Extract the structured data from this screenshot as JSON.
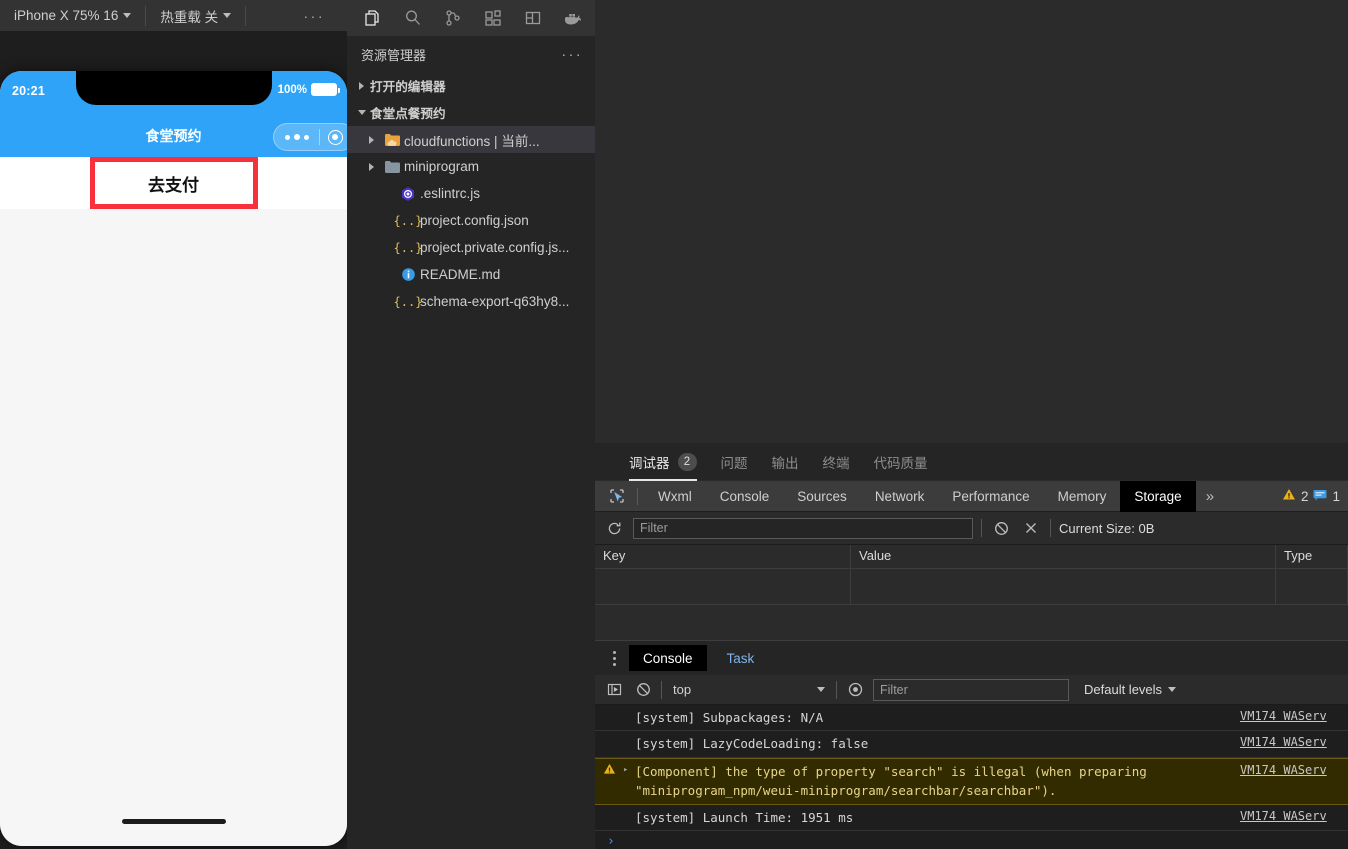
{
  "simulator": {
    "toolbar": {
      "device": "iPhone X 75% 16",
      "hot_reload": "热重载 关",
      "more": "···"
    },
    "phone": {
      "status_time": "20:21",
      "battery_pct": "100%",
      "nav_title": "食堂预约",
      "pay_button": "去支付"
    }
  },
  "activity_bar": {
    "icons": [
      {
        "name": "explorer-icon",
        "label": "资源管理器"
      },
      {
        "name": "search-icon",
        "label": "搜索"
      },
      {
        "name": "source-control-icon",
        "label": "源代码管理"
      },
      {
        "name": "extensions-icon",
        "label": "扩展"
      },
      {
        "name": "layout-icon",
        "label": "布局"
      },
      {
        "name": "docker-icon",
        "label": "Docker"
      }
    ]
  },
  "explorer": {
    "title": "资源管理器",
    "more": "···",
    "tree": [
      {
        "label": "打开的编辑器",
        "type": "section",
        "expanded": false,
        "indent": 0
      },
      {
        "label": "食堂点餐预约",
        "type": "section",
        "expanded": true,
        "indent": 0
      },
      {
        "label": "cloudfunctions | 当前...",
        "type": "folder-cloud",
        "expanded": false,
        "indent": 1,
        "selected": true
      },
      {
        "label": "miniprogram",
        "type": "folder",
        "expanded": false,
        "indent": 1,
        "selected": false
      },
      {
        "label": ".eslintrc.js",
        "type": "eslint",
        "indent": 2,
        "selected": false
      },
      {
        "label": "project.config.json",
        "type": "json",
        "indent": 2,
        "selected": false
      },
      {
        "label": "project.private.config.js...",
        "type": "json",
        "indent": 2,
        "selected": false
      },
      {
        "label": "README.md",
        "type": "info",
        "indent": 2,
        "selected": false
      },
      {
        "label": "schema-export-q63hy8...",
        "type": "json",
        "indent": 2,
        "selected": false
      }
    ]
  },
  "panel": {
    "tabs": [
      {
        "label": "调试器",
        "badge": "2",
        "active": true
      },
      {
        "label": "问题",
        "badge": "",
        "active": false
      },
      {
        "label": "输出",
        "badge": "",
        "active": false
      },
      {
        "label": "终端",
        "badge": "",
        "active": false
      },
      {
        "label": "代码质量",
        "badge": "",
        "active": false
      }
    ]
  },
  "devtools": {
    "tabs": [
      {
        "label": "Wxml",
        "active": false
      },
      {
        "label": "Console",
        "active": false
      },
      {
        "label": "Sources",
        "active": false
      },
      {
        "label": "Network",
        "active": false
      },
      {
        "label": "Performance",
        "active": false
      },
      {
        "label": "Memory",
        "active": false
      },
      {
        "label": "Storage",
        "active": true
      }
    ],
    "overflow": "»",
    "warning_count": "2",
    "message_count": "1"
  },
  "storage": {
    "filter_placeholder": "Filter",
    "filter_value": "",
    "current_size_label": "Current Size: 0B",
    "columns": [
      "Key",
      "Value",
      "Type"
    ],
    "rows": []
  },
  "console": {
    "tabs": [
      {
        "label": "Console",
        "active": true
      },
      {
        "label": "Task",
        "active": false
      }
    ],
    "context": "top",
    "filter_placeholder": "Filter",
    "filter_value": "",
    "levels": "Default levels",
    "prompt": "›",
    "logs": [
      {
        "text": "[system] Subpackages: N/A",
        "level": "info",
        "source": "VM174 WAServ",
        "expandable": false
      },
      {
        "text": "[system] LazyCodeLoading: false",
        "level": "info",
        "source": "VM174 WAServ",
        "expandable": false
      },
      {
        "text": "[Component] the type of property \"search\" is illegal (when preparing \"miniprogram_npm/weui-miniprogram/searchbar/searchbar\").",
        "level": "warning",
        "source": "VM174 WAServ",
        "expandable": true
      },
      {
        "text": "[system] Launch Time: 1951 ms",
        "level": "info",
        "source": "VM174 WAServ",
        "expandable": false
      }
    ]
  },
  "colors": {
    "accent_blue": "#2fa3f7",
    "highlight_red": "#f92f3d",
    "warning_bg": "#332b00",
    "panel_bg": "#252526"
  }
}
